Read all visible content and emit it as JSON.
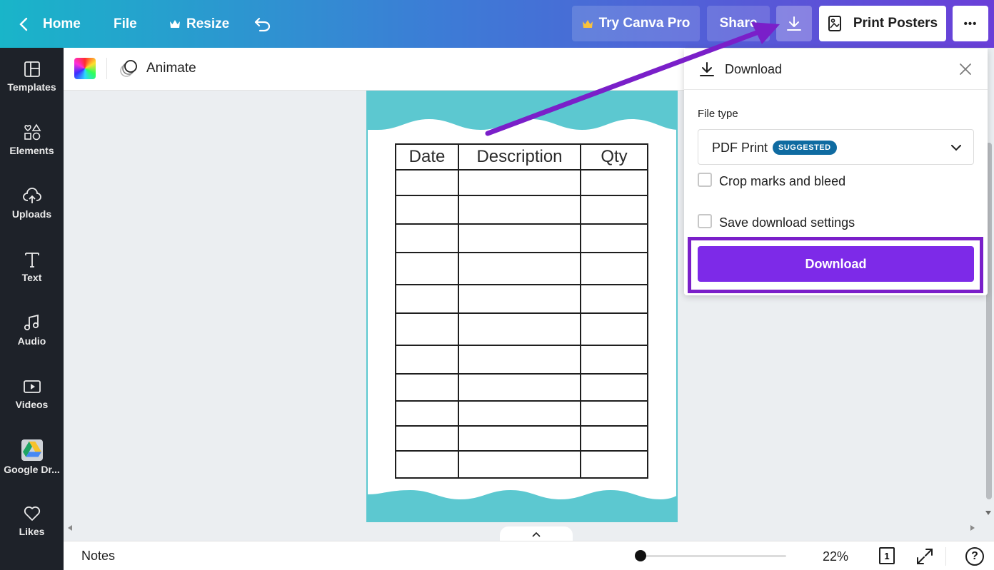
{
  "topbar": {
    "home_label": "Home",
    "file_label": "File",
    "resize_label": "Resize",
    "try_pro_label": "Try Canva Pro",
    "share_label": "Share",
    "print_label": "Print Posters",
    "more_label": "•••"
  },
  "sidebar": {
    "items": [
      {
        "label": "Templates",
        "icon": "templates-icon"
      },
      {
        "label": "Elements",
        "icon": "elements-icon"
      },
      {
        "label": "Uploads",
        "icon": "uploads-icon"
      },
      {
        "label": "Text",
        "icon": "text-icon"
      },
      {
        "label": "Audio",
        "icon": "audio-icon"
      },
      {
        "label": "Videos",
        "icon": "videos-icon"
      },
      {
        "label": "Google Dr...",
        "icon": "google-drive-icon"
      },
      {
        "label": "Likes",
        "icon": "heart-icon"
      }
    ]
  },
  "toolbar": {
    "animate_label": "Animate"
  },
  "design": {
    "table_headers": [
      "Date",
      "Description",
      "Qty"
    ],
    "empty_rows": 11,
    "accent_color": "#5cc8d0"
  },
  "download_panel": {
    "title": "Download",
    "file_type_label": "File type",
    "file_type_value": "PDF Print",
    "suggested_badge": "SUGGESTED",
    "crop_marks_label": "Crop marks and bleed",
    "save_settings_label": "Save download settings",
    "download_button_label": "Download",
    "button_color": "#7d2ae8",
    "highlight_color": "#7a1fc9"
  },
  "bottombar": {
    "notes_label": "Notes",
    "zoom_label": "22%",
    "zoom_fraction": 0.22,
    "page_count": "1"
  }
}
